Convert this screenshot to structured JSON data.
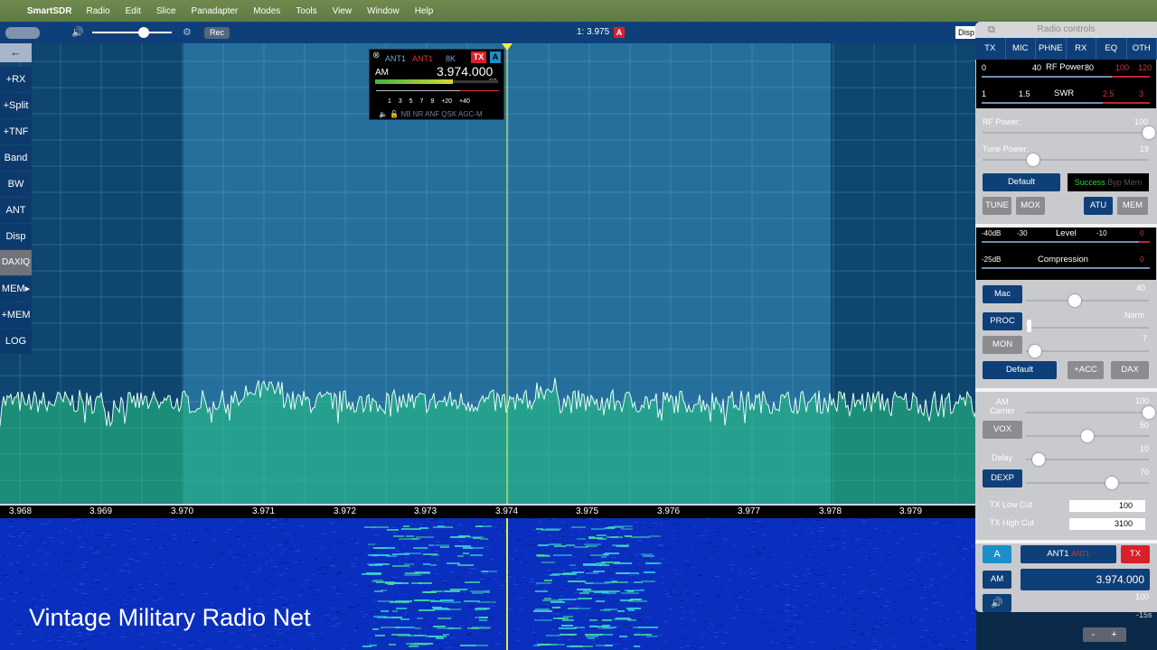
{
  "menubar": {
    "app_name": "SmartSDR",
    "items": [
      "Radio",
      "Edit",
      "Slice",
      "Panadapter",
      "Modes",
      "Tools",
      "View",
      "Window",
      "Help"
    ]
  },
  "topbar": {
    "rec_label": "Rec",
    "slice_title": "1: 3.975",
    "slice_badge": "A",
    "display_button": "Disp"
  },
  "sidebar": {
    "back": "←",
    "items": [
      "+RX",
      "+Split",
      "+TNF",
      "Band",
      "BW",
      "ANT",
      "Disp",
      "DAXIQ",
      "MEM▸",
      "+MEM",
      "LOG"
    ]
  },
  "slice_flag": {
    "rx_ant": "ANT1",
    "tx_ant": "ANT1",
    "bandwidth": "8K",
    "tx_label": "TX",
    "slice_letter": "A",
    "mode": "AM",
    "frequency": "3.974.000",
    "s_reading": "S9",
    "scale": "1 3 5 7 9 +20 +40",
    "dsp_flags": "NB NR ANF QSK AGC-M"
  },
  "freq_scale": [
    "3.968",
    "3.969",
    "3.970",
    "3.971",
    "3.972",
    "3.973",
    "3.974",
    "3.975",
    "3.976",
    "3.977",
    "3.978",
    "3.979"
  ],
  "waterfall": {
    "caption": "Vintage Military Radio Net",
    "timestamp": "-15s",
    "zoom_minus": "-",
    "zoom_plus": "+"
  },
  "radio_controls": {
    "title": "Radio controls",
    "tabs": [
      "TX",
      "MIC",
      "PHNE",
      "RX",
      "EQ",
      "OTH"
    ],
    "tx": {
      "rf_meter_label": "RF Power",
      "rf_meter_ticks": [
        "0",
        "40",
        "80",
        "100",
        "120"
      ],
      "swr_label": "SWR",
      "swr_ticks": [
        "1",
        "1.5",
        "2.5",
        "3"
      ],
      "rf_power_label": "RF Power:",
      "rf_power_value": "100",
      "rf_power_level": 1.0,
      "tune_power_label": "Tune Power:",
      "tune_power_value": "19",
      "tune_power_level": 0.19,
      "default_label": "Default",
      "status_success": "Success",
      "status_extra": "Byp Mem",
      "tune": "TUNE",
      "mox": "MOX",
      "atu": "ATU",
      "mem": "MEM"
    },
    "mic": {
      "level_label": "Level",
      "level_ticks": [
        "-40dB",
        "-30",
        "-10",
        "0"
      ],
      "comp_label": "Compression",
      "comp_ticks": [
        "-25dB",
        "0"
      ],
      "mac": "Mac",
      "mac_value": "40",
      "mac_level": 0.4,
      "proc": "PROC",
      "proc_value": "Norm",
      "mon": "MON",
      "mon_value": "7",
      "mon_level": 0.07,
      "default_label": "Default",
      "acc": "+ACC",
      "dax": "DAX"
    },
    "phne": {
      "am_carrier": "AM\nCarrier",
      "am_carrier_label": "AM",
      "am_carrier_label2": "Carrier",
      "am_carrier_value": "100",
      "am_carrier_level": 1.0,
      "vox": "VOX",
      "vox_value": "50",
      "vox_level": 0.5,
      "delay_label": "Delay",
      "delay_value": "10",
      "delay_level": 0.1,
      "dexp": "DEXP",
      "dexp_value": "70",
      "dexp_level": 0.7,
      "tx_low_cut_label": "TX Low Cut",
      "tx_low_cut_value": "100",
      "tx_high_cut_label": "TX High Cut",
      "tx_high_cut_value": "3100"
    },
    "slice": {
      "letter": "A",
      "rx_ant": "ANT1",
      "tx_ant": "ANT1",
      "tx": "TX",
      "mode": "AM",
      "frequency": "3.974.000",
      "volume_value": "100"
    }
  },
  "colors": {
    "accent_blue": "#0f3f78",
    "tx_red": "#d8202a",
    "success_green": "#37d437"
  }
}
